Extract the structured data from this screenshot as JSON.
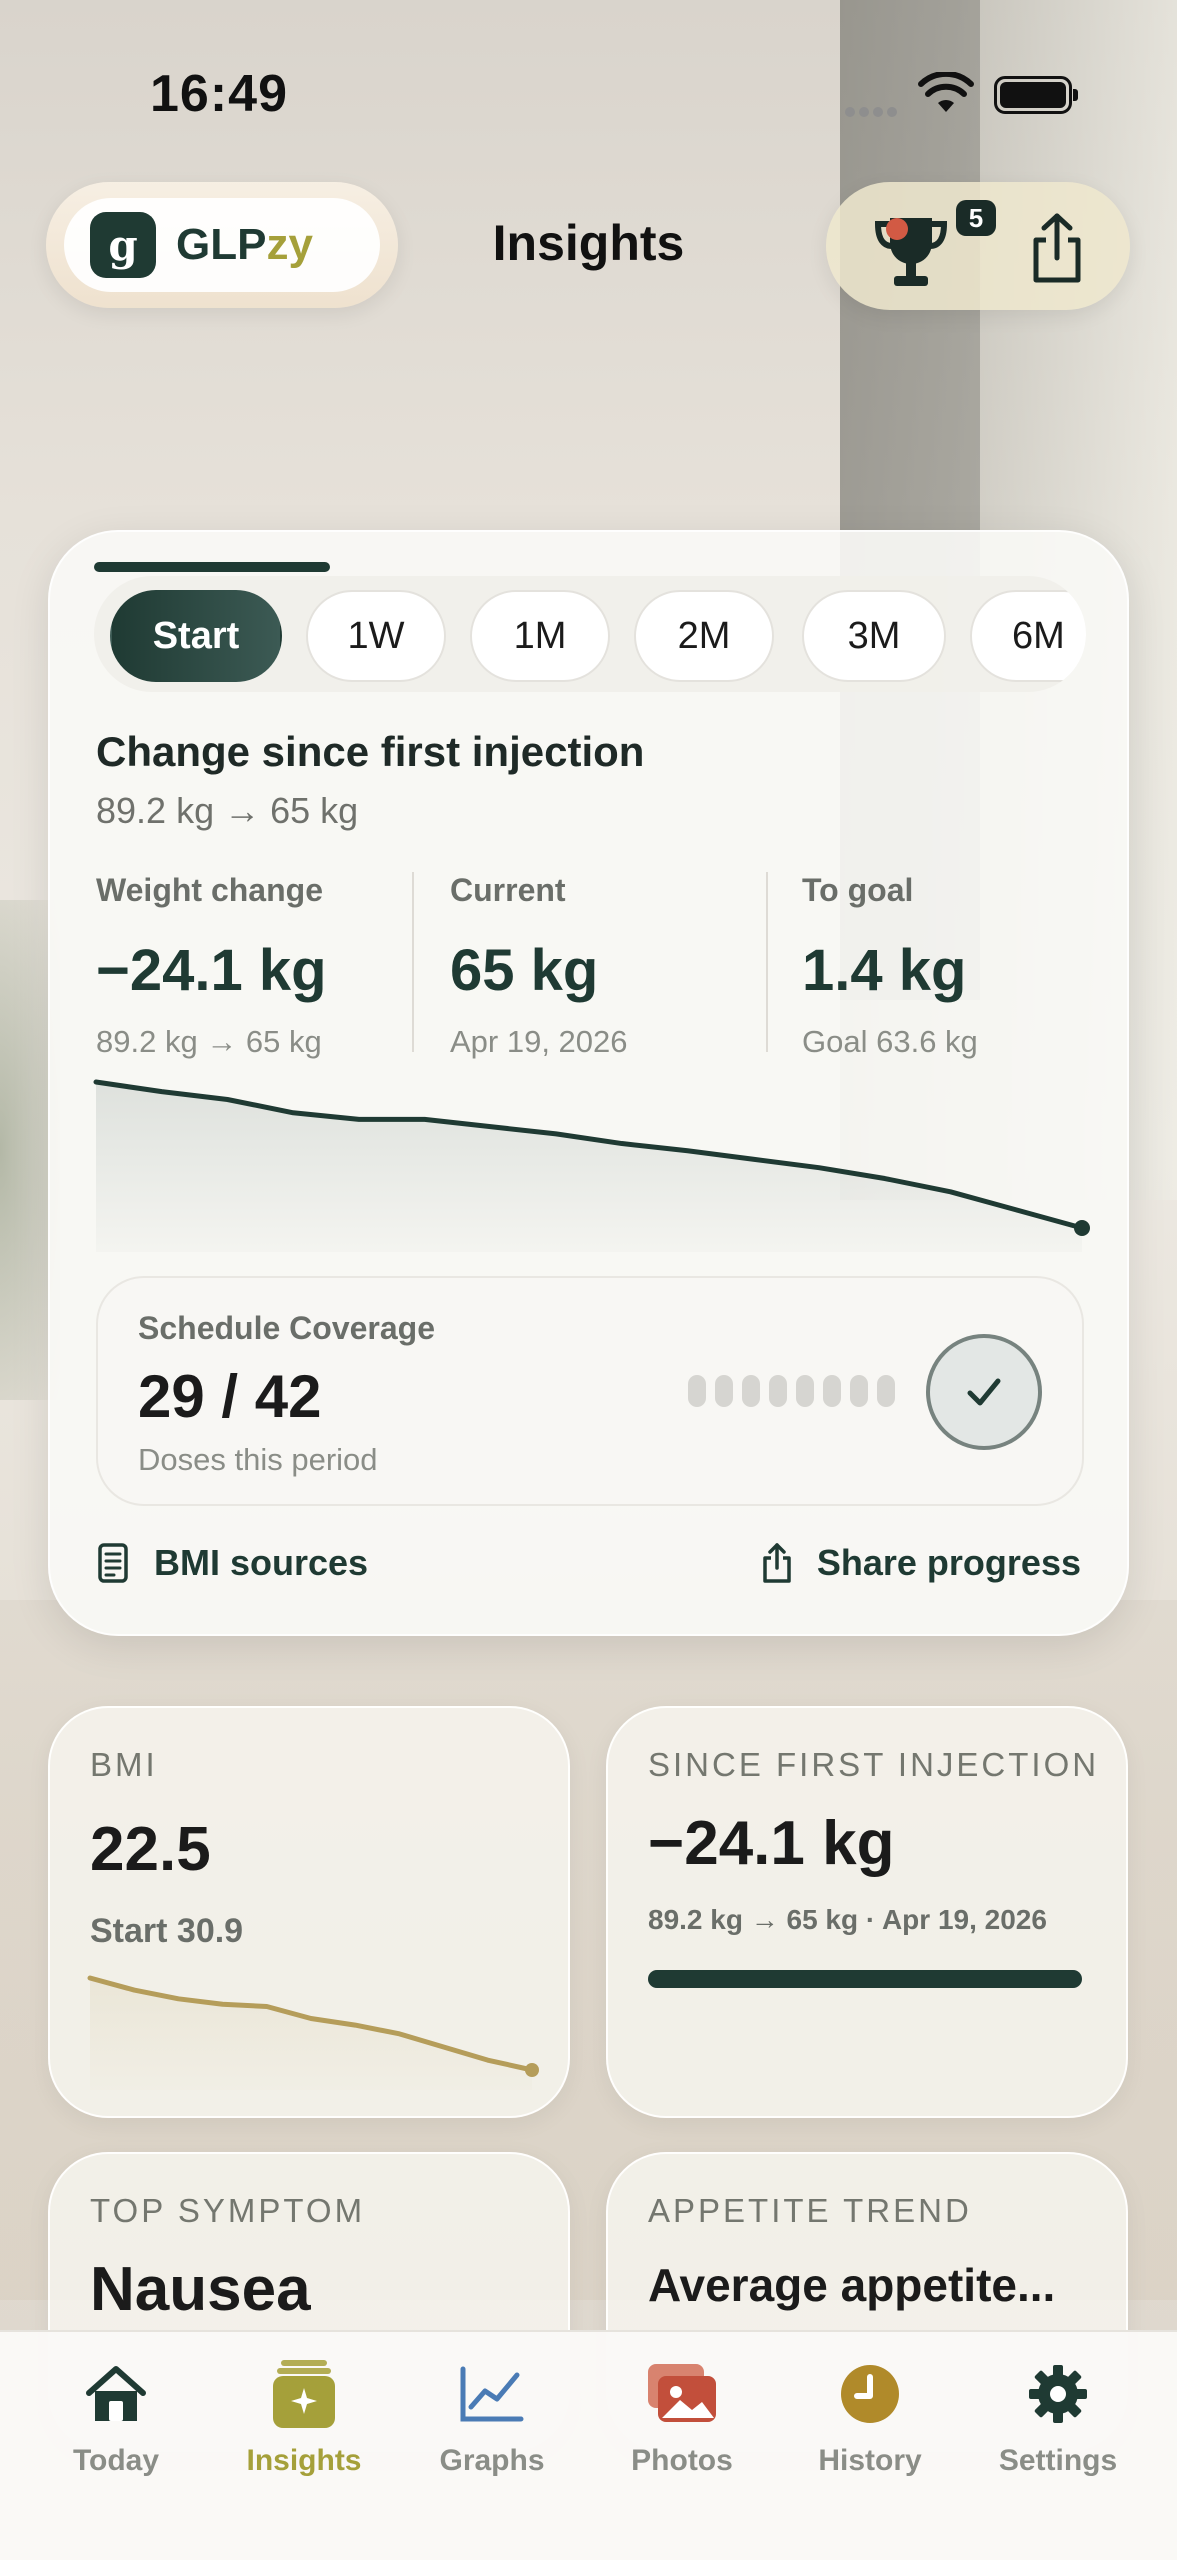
{
  "status_bar": {
    "time": "16:49"
  },
  "header": {
    "brand_name_part1": "GLP",
    "brand_name_part2": "zy",
    "title": "Insights",
    "trophy_badge_count": "5"
  },
  "range_tabs": [
    "Start",
    "1W",
    "1M",
    "2M",
    "3M",
    "6M"
  ],
  "active_range": "Start",
  "summary": {
    "title": "Change since first injection",
    "subtitle": "89.2 kg → 65 kg",
    "stats": [
      {
        "label": "Weight change",
        "value": "−24.1 kg",
        "sub": "89.2 kg → 65 kg"
      },
      {
        "label": "Current",
        "value": "65 kg",
        "sub": "Apr 19, 2026"
      },
      {
        "label": "To goal",
        "value": "1.4 kg",
        "sub": "Goal 63.6 kg"
      }
    ]
  },
  "chart_data": [
    {
      "type": "area",
      "series": [
        {
          "values": [
            89.2,
            87.6,
            86.3,
            84.1,
            83.0,
            83.0,
            81.8,
            80.6,
            79.0,
            77.8,
            76.4,
            75.0,
            73.2,
            71.0,
            68.0,
            65.0
          ]
        }
      ],
      "grid": false,
      "color": "#1f3a33"
    },
    {
      "type": "line",
      "series": [
        {
          "values": [
            30.9,
            29.8,
            29.0,
            28.5,
            28.3,
            27.2,
            26.6,
            25.8,
            24.6,
            23.4,
            22.5
          ]
        }
      ],
      "grid": false,
      "color": "#b59d5a"
    }
  ],
  "coverage": {
    "label": "Schedule Coverage",
    "value": "29 / 42",
    "sub": "Doses this period",
    "dot_count": 8
  },
  "card_footer": {
    "left_label": "BMI sources",
    "right_label": "Share progress"
  },
  "tiles": {
    "bmi": {
      "label": "BMI",
      "value": "22.5",
      "sub": "Start 30.9"
    },
    "since": {
      "label": "SINCE FIRST INJECTION",
      "value": "−24.1 kg",
      "sub": "89.2 kg → 65 kg · Apr 19, 2026",
      "progress": 1.0
    },
    "symptom": {
      "label": "TOP SYMPTOM",
      "value": "Nausea"
    },
    "appetite": {
      "label": "APPETITE TREND",
      "value": "Average appetite..."
    }
  },
  "tab_bar": [
    {
      "label": "Today",
      "icon": "home-icon"
    },
    {
      "label": "Insights",
      "icon": "insights-icon"
    },
    {
      "label": "Graphs",
      "icon": "graph-icon"
    },
    {
      "label": "Photos",
      "icon": "photos-icon"
    },
    {
      "label": "History",
      "icon": "clock-icon"
    },
    {
      "label": "Settings",
      "icon": "gear-icon"
    }
  ],
  "colors": {
    "primary": "#1f3a33",
    "accent": "#a5a03a",
    "bmi_line": "#b59d5a",
    "photos_tab": "#c24f3b",
    "history_tab": "#b08a2a",
    "graphs_tab": "#4a7bb5"
  }
}
